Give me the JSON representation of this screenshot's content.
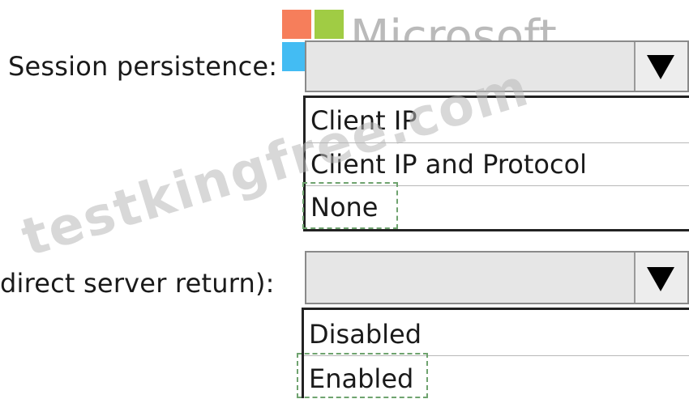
{
  "watermarks": {
    "logo_text": "Microsoft",
    "site_text": "testkingfree.com",
    "logo_colors": [
      "#f35325",
      "#81bc06",
      "#05a6f0",
      "#ffba08"
    ]
  },
  "session_persistence": {
    "label": "Session persistence:",
    "selected_value": "",
    "options": [
      "Client IP",
      "Client IP and Protocol",
      "None"
    ],
    "selected_option": "None"
  },
  "floating_ip": {
    "label": "direct server return):",
    "selected_value": "",
    "options": [
      "Disabled",
      "Enabled"
    ],
    "selected_option": "Enabled"
  },
  "icons": {
    "dropdown": "chevron-down-icon"
  }
}
